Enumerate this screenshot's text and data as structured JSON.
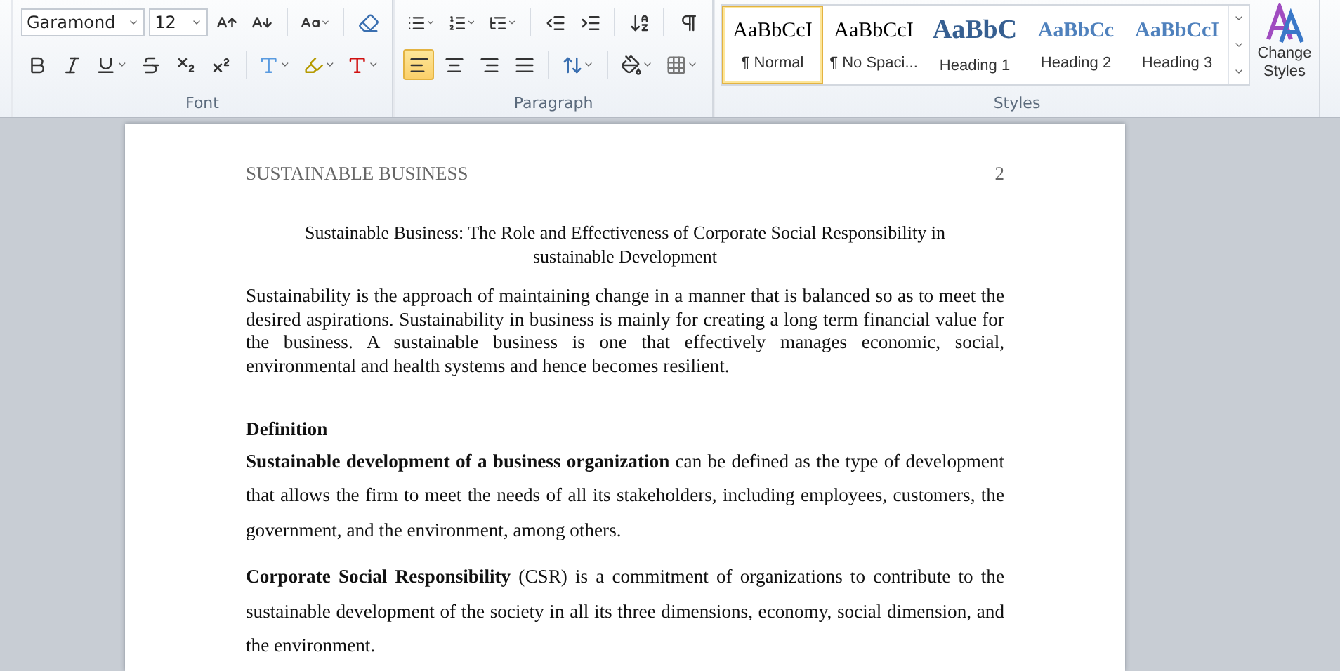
{
  "font_group": {
    "font_name": "Garamond",
    "font_size": "12",
    "label": "Font"
  },
  "paragraph_group": {
    "label": "Paragraph",
    "alignments": [
      {
        "kind": "left",
        "selected": true
      },
      {
        "kind": "center",
        "selected": false
      },
      {
        "kind": "right",
        "selected": false
      },
      {
        "kind": "justify",
        "selected": false
      }
    ]
  },
  "styles_group": {
    "label": "Styles",
    "change_styles": "Change Styles",
    "styles": [
      {
        "kind": "normal",
        "preview": "AaBbCcI",
        "name": "¶ Normal",
        "selected": true
      },
      {
        "kind": "normal",
        "preview": "AaBbCcI",
        "name": "¶ No Spaci...",
        "selected": false
      },
      {
        "kind": "heading1",
        "preview": "AaBbC",
        "name": "Heading 1",
        "selected": false
      },
      {
        "kind": "heading2",
        "preview": "AaBbCc",
        "name": "Heading 2",
        "selected": false
      },
      {
        "kind": "heading3",
        "preview": "AaBbCcI",
        "name": "Heading 3",
        "selected": false
      }
    ]
  },
  "document": {
    "running_head": "SUSTAINABLE BUSINESS",
    "page_number": "2",
    "title": "Sustainable Business: The Role and Effectiveness of Corporate Social Responsibility in sustainable Development",
    "blocks": [
      {
        "kind": "compact",
        "text": "Sustainability is the approach of maintaining change in a manner that is balanced so as to meet the desired aspirations. Sustainability in business is mainly for creating a long term financial value for the business. A sustainable business is one that effectively manages economic, social, environmental and health systems and hence becomes resilient."
      },
      {
        "kind": "heading",
        "text": "Definition"
      },
      {
        "kind": "spaced",
        "text": "**Sustainable development of a business organization** can be defined as the type of development that allows the firm to meet the needs of all its stakeholders, including employees, customers, the government, and the environment, among others."
      },
      {
        "kind": "spaced",
        "text": "**Corporate Social Responsibility** (CSR) is a commitment of organizations to contribute to the sustainable development of the society in all its three dimensions, economy, social dimension, and the environment."
      }
    ]
  }
}
